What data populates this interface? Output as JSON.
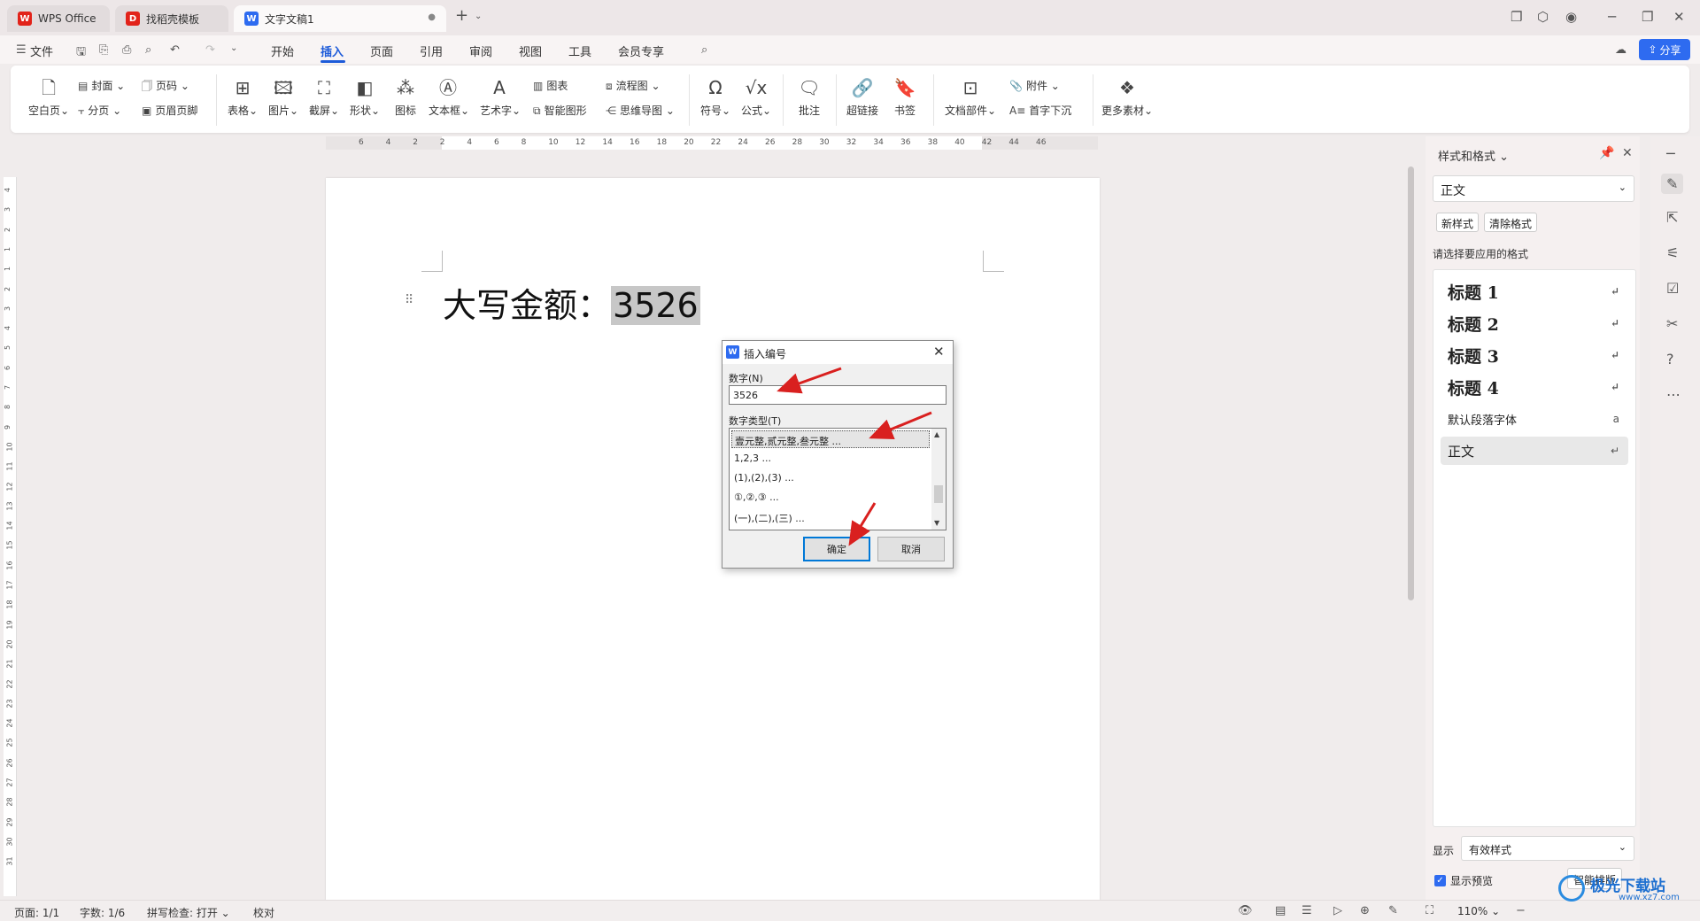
{
  "titlebar": {
    "tabs": [
      {
        "label": "WPS Office",
        "icon": "wps-logo-icon"
      },
      {
        "label": "找稻壳模板",
        "icon": "docer-logo-icon"
      },
      {
        "label": "文字文稿1",
        "icon": "writer-logo-icon",
        "active": true
      }
    ],
    "new_tab": "+"
  },
  "menubar": {
    "file_label": "文件",
    "tabs": [
      "开始",
      "插入",
      "页面",
      "引用",
      "审阅",
      "视图",
      "工具",
      "会员专享"
    ],
    "active_tab": "插入",
    "share_label": "分享"
  },
  "ribbon": {
    "blank_page": "空白页",
    "cover": "封面",
    "page_break": "分页",
    "page_number": "页码",
    "header_footer": "页眉页脚",
    "table": "表格",
    "picture": "图片",
    "screenshot": "截屏",
    "shape": "形状",
    "icon": "图标",
    "textbox": "文本框",
    "wordart": "艺术字",
    "chart": "图表",
    "smart_graphic": "智能图形",
    "flowchart": "流程图",
    "mindmap": "思维导图",
    "symbol": "符号",
    "formula": "公式",
    "comment": "批注",
    "hyperlink": "超链接",
    "bookmark": "书签",
    "doc_parts": "文档部件",
    "attachment": "附件",
    "drop_cap": "首字下沉",
    "more_materials": "更多素材"
  },
  "h_ruler_ticks": [
    "6",
    "4",
    "2",
    "2",
    "4",
    "6",
    "8",
    "10",
    "12",
    "14",
    "16",
    "18",
    "20",
    "22",
    "24",
    "26",
    "28",
    "30",
    "32",
    "34",
    "36",
    "38",
    "40",
    "42",
    "44",
    "46"
  ],
  "v_ruler_ticks": [
    "4",
    "3",
    "2",
    "1",
    "1",
    "2",
    "3",
    "4",
    "5",
    "6",
    "7",
    "8",
    "9",
    "10",
    "11",
    "12",
    "13",
    "14",
    "15",
    "16",
    "17",
    "18",
    "19",
    "20",
    "21",
    "22",
    "23",
    "24",
    "25",
    "26",
    "27",
    "28",
    "29",
    "30",
    "31"
  ],
  "document": {
    "label_text": "大写金额：",
    "selected_text": "3526"
  },
  "dialog": {
    "title": "插入编号",
    "number_label": "数字(N)",
    "number_value": "3526",
    "type_label": "数字类型(T)",
    "types": [
      "壹元整,贰元整,叁元整 ...",
      "1,2,3 ...",
      "(1),(2),(3) ...",
      "①,②,③ ...",
      "(一),(二),(三) ..."
    ],
    "ok_label": "确定",
    "cancel_label": "取消"
  },
  "style_panel": {
    "title": "样式和格式",
    "current_style": "正文",
    "new_style": "新样式",
    "clear_format": "清除格式",
    "apply_label": "请选择要应用的格式",
    "styles": [
      "标题 1",
      "标题 2",
      "标题 3",
      "标题 4",
      "默认段落字体",
      "正文"
    ],
    "show_label": "显示",
    "show_value": "有效样式",
    "preview_label": "显示预览",
    "smart_label": "智能排版"
  },
  "statusbar": {
    "page": "页面: 1/1",
    "words": "字数: 1/6",
    "spellcheck": "拼写检查: 打开",
    "proofread": "校对",
    "zoom": "110%"
  },
  "watermark": {
    "text": "极光下载站",
    "url": "www.xz7.com"
  },
  "colors": {
    "accent": "#2e6bf0",
    "annotation_arrow": "#d9201f"
  }
}
